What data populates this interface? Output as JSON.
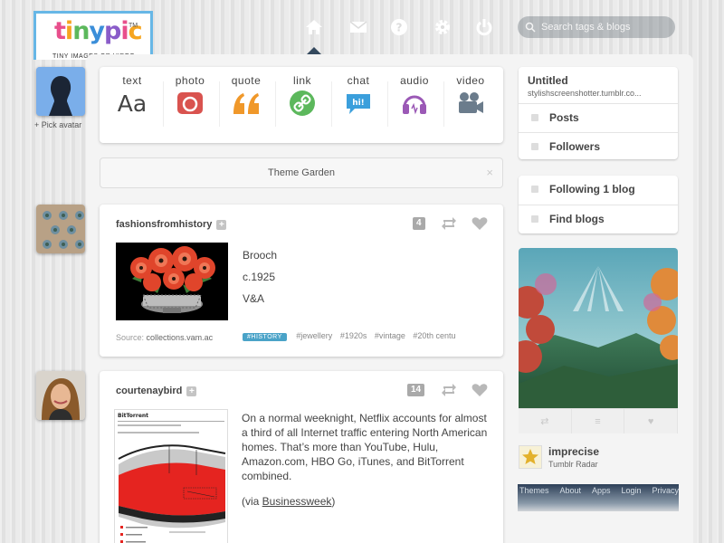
{
  "logo": {
    "letters": [
      "t",
      "i",
      "n",
      "y",
      "p",
      "i",
      "c"
    ],
    "tm": "TM",
    "tagline": "TINY IMAGES OR VIDEO"
  },
  "nav": {
    "icons": [
      "home-icon",
      "mail-icon",
      "help-icon",
      "gear-icon",
      "power-icon"
    ],
    "active": "home-icon",
    "search_placeholder": "Search tags & blogs"
  },
  "avatar": {
    "pick_label": "+ Pick avatar"
  },
  "post_types": [
    {
      "label": "text",
      "glyph": "Aa",
      "color": "#444444"
    },
    {
      "label": "photo",
      "color": "#d9534f"
    },
    {
      "label": "quote",
      "color": "#f0982a"
    },
    {
      "label": "link",
      "color": "#5cb85c"
    },
    {
      "label": "chat",
      "glyph": "hi!",
      "color": "#3b9fdc"
    },
    {
      "label": "audio",
      "color": "#9b59b6"
    },
    {
      "label": "video",
      "color": "#6b7c8c"
    }
  ],
  "theme_garden": {
    "label": "Theme Garden",
    "close": "×"
  },
  "posts": [
    {
      "blog": "fashionsfromhistory",
      "plus": "+",
      "notes": "4",
      "lines": [
        "Brooch",
        "c.1925",
        "V&A"
      ],
      "source_label": "Source:",
      "source": "collections.vam.ac",
      "tag_chip": "#HISTORY",
      "tags": [
        "#jewellery",
        "#1920s",
        "#vintage",
        "#20th centu"
      ]
    },
    {
      "blog": "courtenaybird",
      "plus": "+",
      "notes": "14",
      "body": "On a normal weeknight, Netflix accounts for almost a third of all Internet traffic entering North American homes. That’s more than YouTube, Hulu, Amazon.com, HBO Go, iTunes, and BitTorrent combined.",
      "via_prefix": "(via ",
      "via_link": "Businessweek",
      "via_suffix": ")",
      "chart_title": "BitTorrent"
    }
  ],
  "sidebar": {
    "blog_title": "Untitled",
    "blog_url": "stylishscreenshotter.tumblr.co...",
    "menu1": [
      "Posts",
      "Followers"
    ],
    "menu2": [
      "Following 1 blog",
      "Find blogs"
    ],
    "radar": {
      "name": "imprecise",
      "label": "Tumblr Radar"
    },
    "footer_links": [
      "Themes",
      "About",
      "Apps",
      "Login",
      "Privacy"
    ]
  }
}
